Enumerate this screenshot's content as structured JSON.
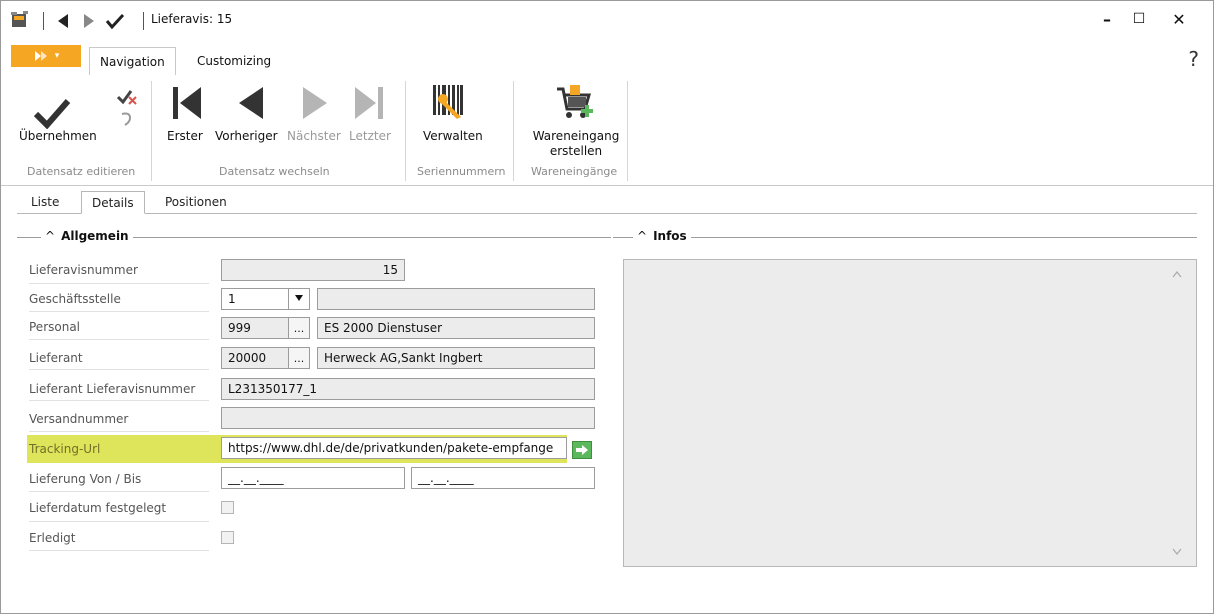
{
  "window": {
    "title": "Lieferavis: 15",
    "minimize": "–",
    "maximize": "☐",
    "close": "✕"
  },
  "ribbon": {
    "tabs": [
      {
        "label": "Navigation",
        "active": true
      },
      {
        "label": "Customizing",
        "active": false
      }
    ],
    "help": "?",
    "groups": [
      {
        "label": "Datensatz editieren",
        "buttons": [
          {
            "label": "Übernehmen"
          }
        ]
      },
      {
        "label": "Datensatz wechseln",
        "buttons": [
          {
            "label": "Erster",
            "enabled": true
          },
          {
            "label": "Vorheriger",
            "enabled": true
          },
          {
            "label": "Nächster",
            "enabled": false
          },
          {
            "label": "Letzter",
            "enabled": false
          }
        ]
      },
      {
        "label": "Seriennummern",
        "buttons": [
          {
            "label": "Verwalten"
          }
        ]
      },
      {
        "label": "Wareneingänge",
        "buttons": [
          {
            "label_line1": "Wareneingang",
            "label_line2": "erstellen"
          }
        ]
      }
    ]
  },
  "content_tabs": [
    {
      "label": "Liste",
      "active": false
    },
    {
      "label": "Details",
      "active": true
    },
    {
      "label": "Positionen",
      "active": false
    }
  ],
  "sections": {
    "allgemein": "Allgemein",
    "infos": "Infos",
    "collapse_glyph": "^"
  },
  "form": {
    "lieferavisnummer": {
      "label": "Lieferavisnummer",
      "value": "15"
    },
    "geschaeftsstelle": {
      "label": "Geschäftsstelle",
      "value": "1",
      "name": ""
    },
    "personal": {
      "label": "Personal",
      "value": "999",
      "name": "ES 2000 Dienstuser"
    },
    "lieferant": {
      "label": "Lieferant",
      "value": "20000",
      "name": "Herweck AG,Sankt Ingbert"
    },
    "lieferant_lieferavisnummer": {
      "label": "Lieferant Lieferavisnummer",
      "value": "L231350177_1"
    },
    "versandnummer": {
      "label": "Versandnummer",
      "value": ""
    },
    "tracking_url": {
      "label": "Tracking-Url",
      "value": "https://www.dhl.de/de/privatkunden/pakete-empfange"
    },
    "lieferung_von_bis": {
      "label": "Lieferung Von / Bis",
      "von": "__.__.____",
      "bis": "__.__.____"
    },
    "lieferdatum_festgelegt": {
      "label": "Lieferdatum festgelegt",
      "checked": false
    },
    "erledigt": {
      "label": "Erledigt",
      "checked": false
    }
  },
  "ellipsis": "...",
  "colors": {
    "accent_orange": "#f5a623",
    "highlight_yellow": "#dfe55a",
    "go_green": "#5cb85c"
  }
}
